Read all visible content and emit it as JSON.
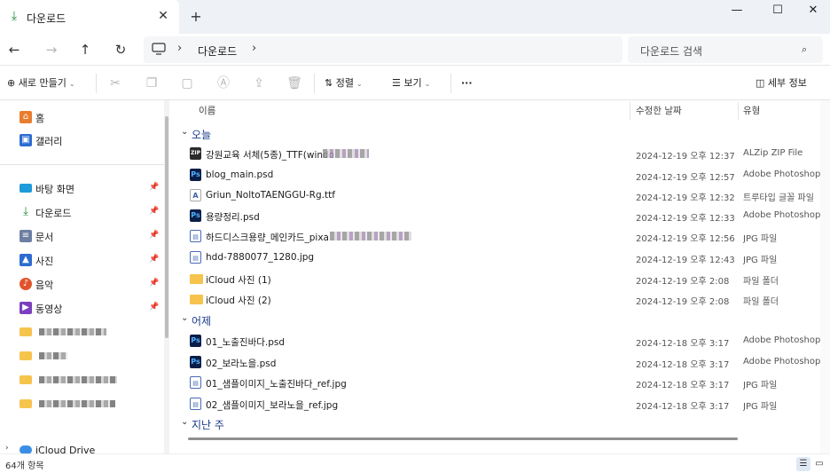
{
  "tab": {
    "title": "다운로드",
    "close": "✕",
    "new": "+"
  },
  "window": {
    "minimize": "—",
    "maximize": "☐",
    "close": "✕"
  },
  "address": {
    "path": [
      "다운로드"
    ],
    "search_placeholder": "다운로드 검색"
  },
  "toolbar": {
    "new_label": "새로 만들기",
    "sort_label": "정렬",
    "view_label": "보기",
    "more_label": "···",
    "details_label": "세부 정보"
  },
  "sidebar": {
    "quick": [
      {
        "label": "홈",
        "icon": "home-icon"
      },
      {
        "label": "갤러리",
        "icon": "gallery-icon"
      }
    ],
    "pinned": [
      {
        "label": "바탕 화면",
        "icon": "desktop-icon"
      },
      {
        "label": "다운로드",
        "icon": "download-icon"
      },
      {
        "label": "문서",
        "icon": "documents-icon"
      },
      {
        "label": "사진",
        "icon": "pictures-icon"
      },
      {
        "label": "음악",
        "icon": "music-icon"
      },
      {
        "label": "동영상",
        "icon": "videos-icon"
      }
    ],
    "drive": {
      "label": "iCloud Drive"
    }
  },
  "columns": {
    "name": "이름",
    "date": "수정한 날짜",
    "type": "유형"
  },
  "groups": [
    {
      "label": "오늘",
      "files": [
        {
          "name": "강원교육 서체(5종)_TTF(windo",
          "date": "2024-12-19 오후 12:37",
          "type": "ALZip ZIP File",
          "icon": "zip"
        },
        {
          "name": "blog_main.psd",
          "date": "2024-12-19 오후 12:57",
          "type": "Adobe Photoshop...",
          "icon": "psd"
        },
        {
          "name": "Griun_NoltoTAENGGU-Rg.ttf",
          "date": "2024-12-19 오후 12:32",
          "type": "트루타입 글꼴 파일",
          "icon": "ttf"
        },
        {
          "name": "용량정리.psd",
          "date": "2024-12-19 오후 12:33",
          "type": "Adobe Photoshop...",
          "icon": "psd"
        },
        {
          "name": "하드디스크용량_메인카드_pixa",
          "date": "2024-12-19 오후 12:56",
          "type": "JPG 파일",
          "icon": "jpg"
        },
        {
          "name": "hdd-7880077_1280.jpg",
          "date": "2024-12-19 오후 12:43",
          "type": "JPG 파일",
          "icon": "jpg"
        },
        {
          "name": "iCloud 사진 (1)",
          "date": "2024-12-19 오후 2:08",
          "type": "파일 폴더",
          "icon": "folder"
        },
        {
          "name": "iCloud 사진 (2)",
          "date": "2024-12-19 오후 2:08",
          "type": "파일 폴더",
          "icon": "folder"
        }
      ]
    },
    {
      "label": "어제",
      "files": [
        {
          "name": "01_노출진바다.psd",
          "date": "2024-12-18 오후 3:17",
          "type": "Adobe Photoshop...",
          "icon": "psd"
        },
        {
          "name": "02_보라노을.psd",
          "date": "2024-12-18 오후 3:17",
          "type": "Adobe Photoshop...",
          "icon": "psd"
        },
        {
          "name": "01_샘플이미지_노출진바다_ref.jpg",
          "date": "2024-12-18 오후 3:17",
          "type": "JPG 파일",
          "icon": "jpg"
        },
        {
          "name": "02_샘플이미지_보라노을_ref.jpg",
          "date": "2024-12-18 오후 3:17",
          "type": "JPG 파일",
          "icon": "jpg"
        }
      ]
    },
    {
      "label": "지난 주",
      "files": []
    }
  ],
  "status": {
    "count": "64개 항목"
  }
}
